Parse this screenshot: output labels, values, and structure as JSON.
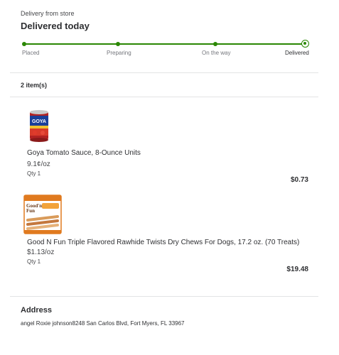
{
  "header": {
    "delivery_type": "Delivery from store",
    "status_title": "Delivered today"
  },
  "tracker": {
    "steps": [
      "Placed",
      "Preparing",
      "On the way",
      "Delivered"
    ],
    "current_step": "Delivered",
    "progress_fraction": 1.0,
    "accent_color": "#2a8703"
  },
  "items": {
    "count_label": "2 item(s)",
    "list": [
      {
        "name": "Goya Tomato Sauce, 8-Ounce Units",
        "unit_price": "9.1¢/oz",
        "qty": "Qty 1",
        "price": "$0.73",
        "image_icon": "goya-can-image",
        "image_text": "GOYA"
      },
      {
        "name": "Good N Fun Triple Flavored Rawhide Twists Dry Chews For Dogs, 17.2 oz. (70 Treats)",
        "unit_price": "$1.13/oz",
        "qty": "Qty 1",
        "price": "$19.48",
        "image_icon": "dog-chews-package-image",
        "image_text_1": "Good'n",
        "image_text_2": "Fun"
      }
    ]
  },
  "address": {
    "title": "Address",
    "line": "angel Roxie johnson8248 San Carlos Blvd, Fort Myers, FL 33967"
  }
}
